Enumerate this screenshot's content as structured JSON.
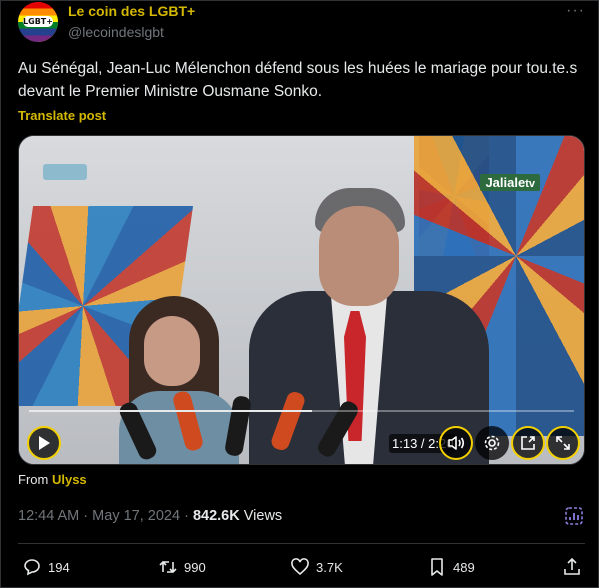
{
  "header": {
    "display_name": "Le coin des LGBT+",
    "handle": "@lecoindeslgbt",
    "avatar_label": "LGBT+",
    "more_label": "···"
  },
  "post": {
    "text": "Au Sénégal, Jean-Luc Mélenchon défend sous les huées le mariage pour tou.te.s devant le Premier Ministre Ousmane Sonko.",
    "translate_label": "Translate post"
  },
  "video": {
    "channel_name": "Jaliale",
    "channel_suffix": "tv",
    "time_display": "1:13 / 2:20",
    "progress": 0.52
  },
  "source": {
    "prefix": "From",
    "name": "Ulyss"
  },
  "meta": {
    "time": "12:44 AM",
    "separator": "·",
    "date": "May 17, 2024",
    "views_count": "842.6K",
    "views_label": "Views"
  },
  "actions": {
    "replies": "194",
    "reposts": "990",
    "likes": "3.7K",
    "bookmarks": "489"
  },
  "colors": {
    "accent": "#d4b800",
    "background": "#000000",
    "muted": "#71767b",
    "text": "#e7e9ea"
  }
}
